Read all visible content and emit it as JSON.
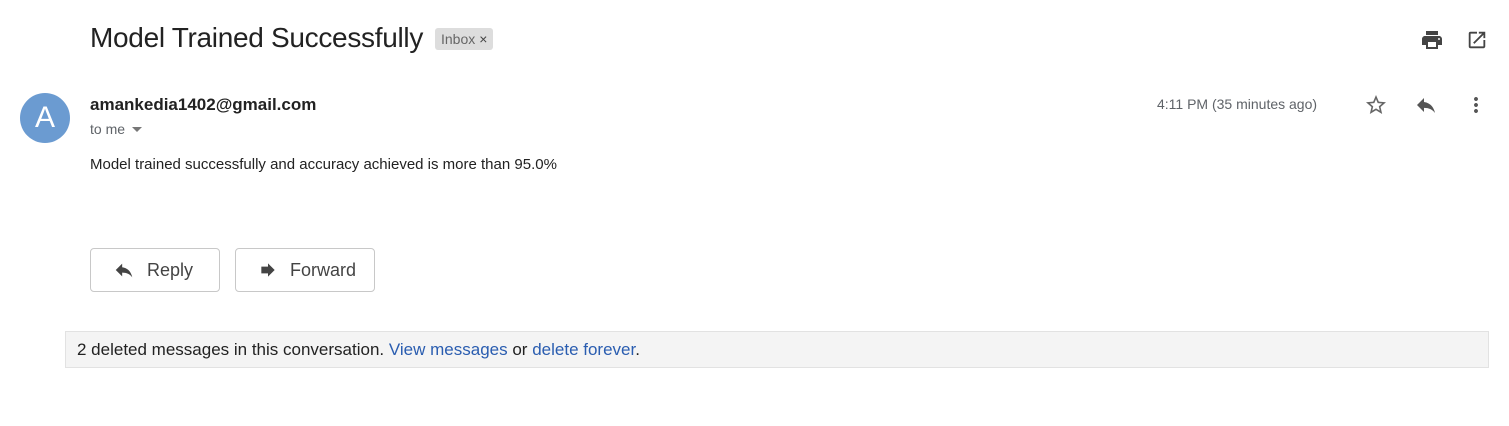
{
  "email": {
    "subject": "Model Trained Successfully",
    "label": "Inbox",
    "label_remove": "×",
    "avatar_letter": "A",
    "sender": "amankedia1402@gmail.com",
    "recipient": "to me",
    "time": "4:11 PM (35 minutes ago)",
    "body": "Model trained successfully and accuracy achieved is more than 95.0%"
  },
  "icons": {
    "print": "print-icon",
    "open_new_window": "open-in-new-window-icon",
    "star": "star-icon",
    "reply": "reply-icon",
    "more": "more-vert-icon",
    "forward": "forward-icon"
  },
  "actions": {
    "reply_label": "Reply",
    "forward_label": "Forward"
  },
  "deleted_notice": {
    "prefix": "2 deleted messages in this conversation.",
    "view_link": "View messages",
    "middle": "or",
    "delete_link": "delete forever",
    "suffix": "."
  },
  "colors": {
    "avatar": "#6b9bd1",
    "link": "#2a5db0",
    "icon": "#555555"
  }
}
